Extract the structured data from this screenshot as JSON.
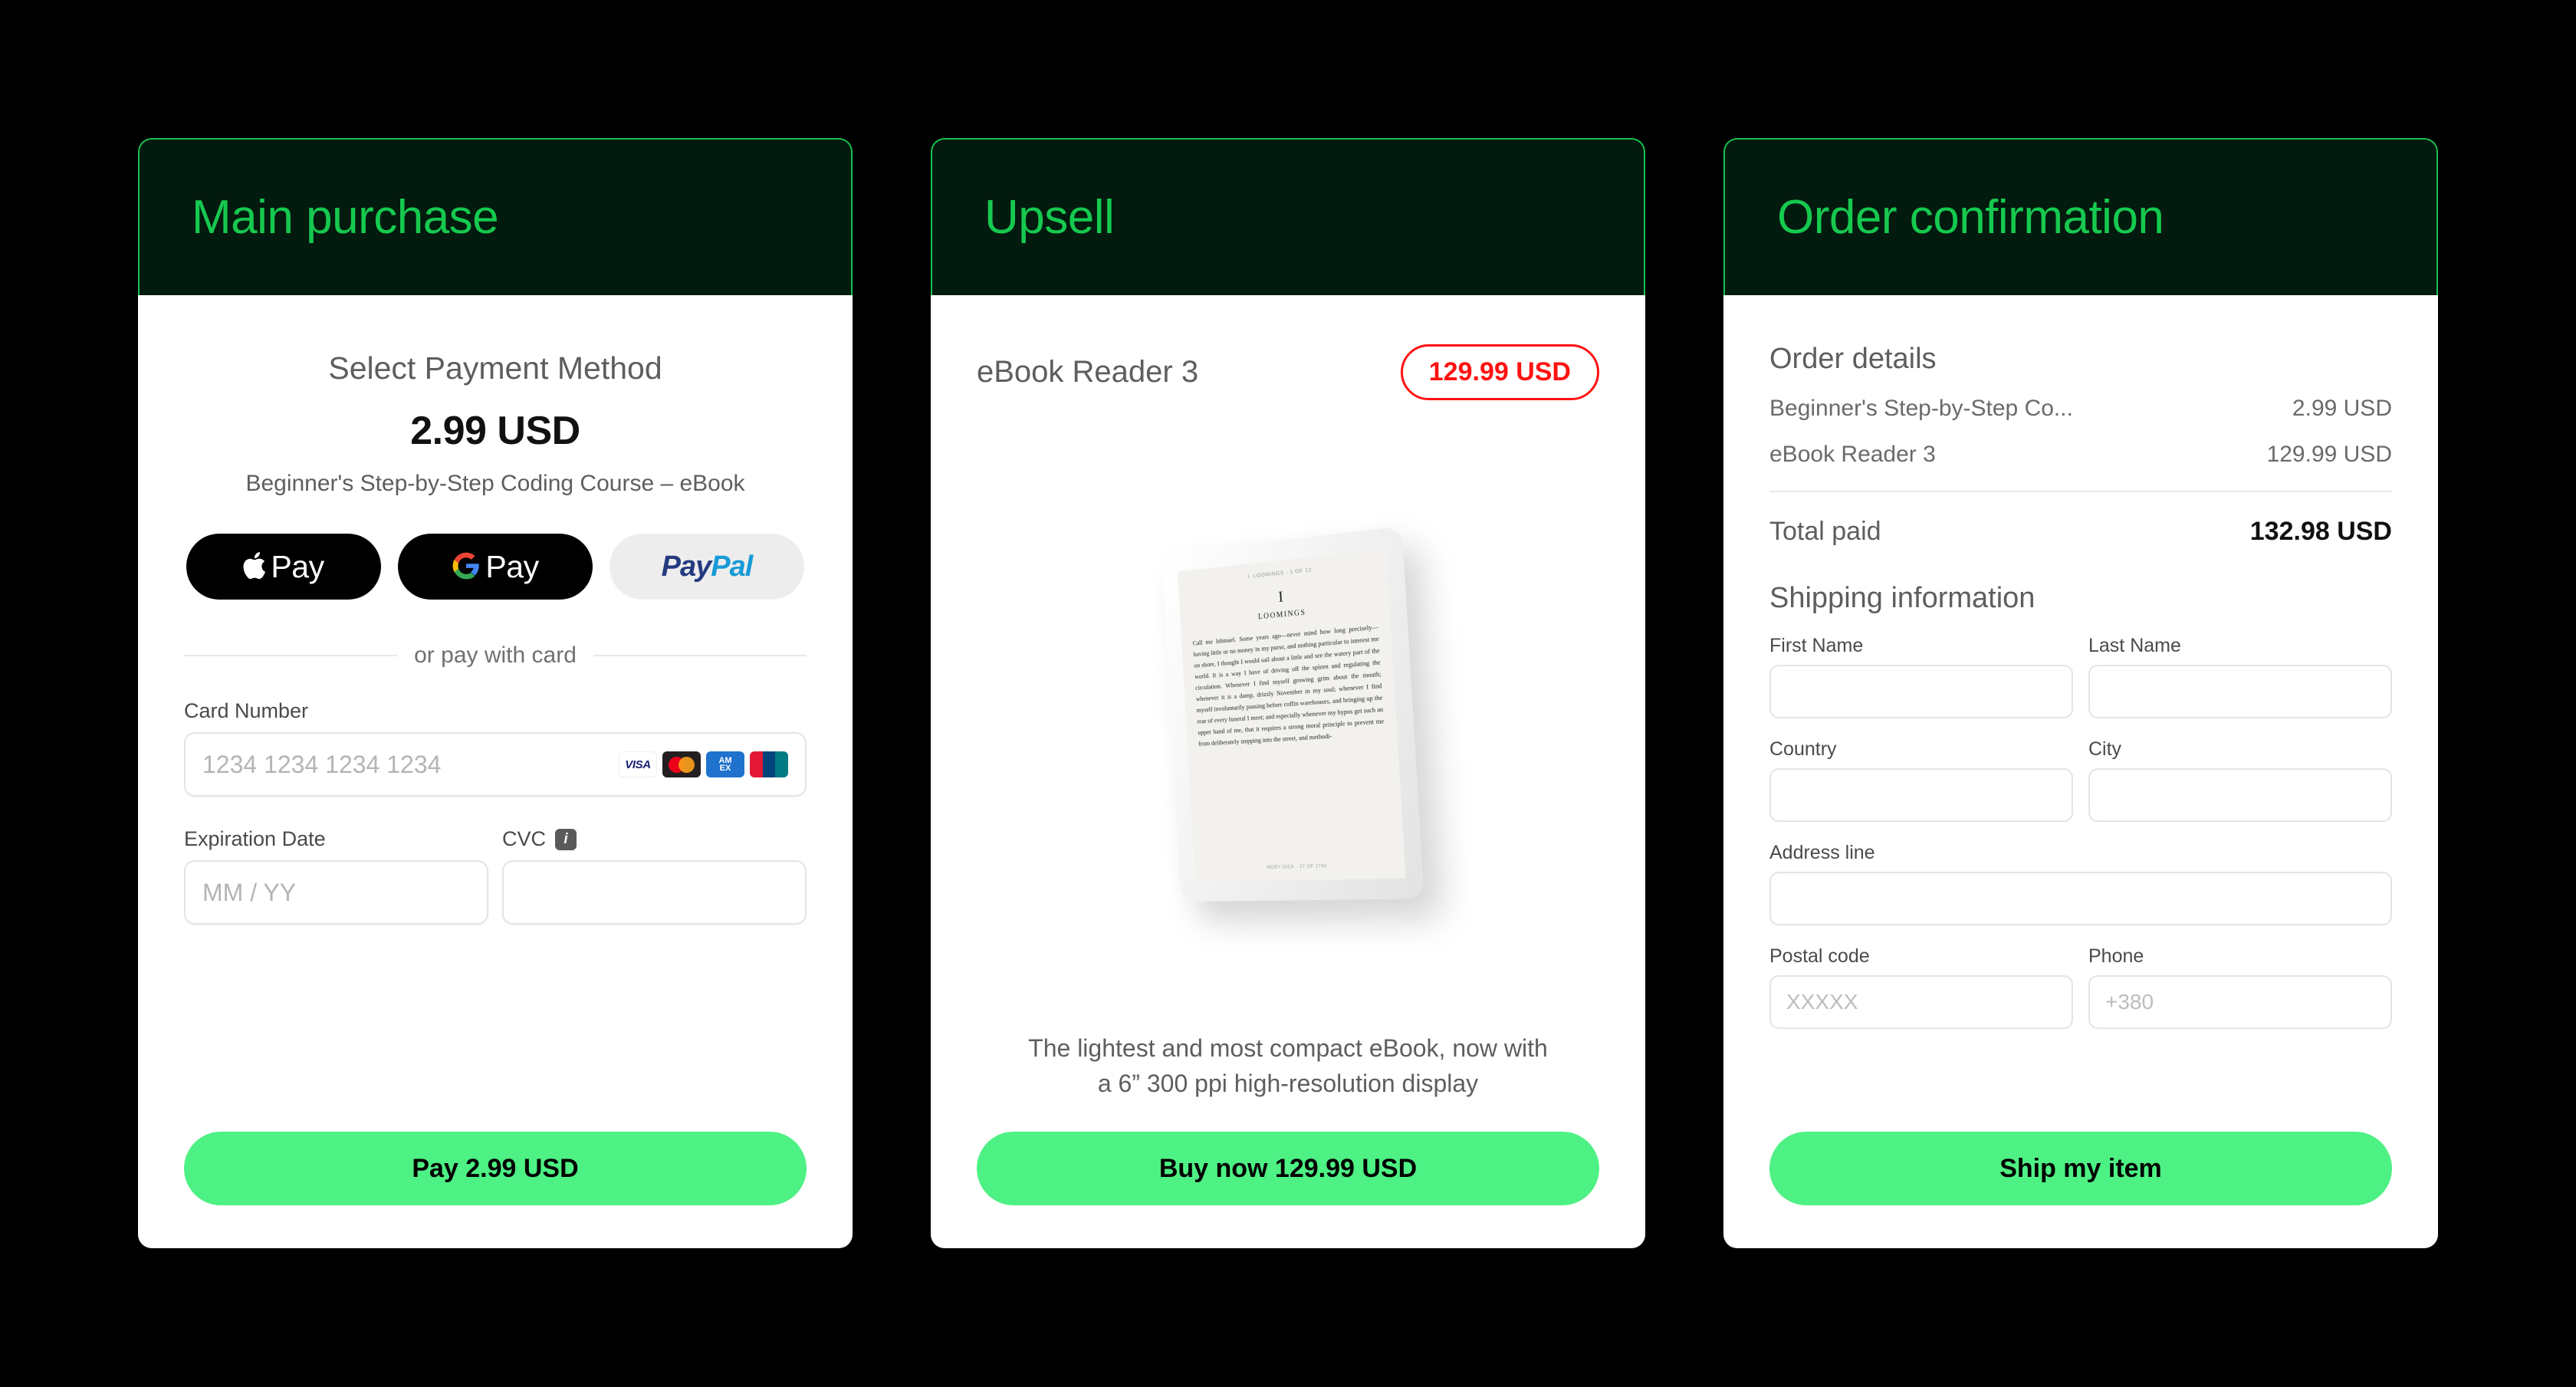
{
  "panels": {
    "main": {
      "title": "Main purchase",
      "select_payment_heading": "Select Payment Method",
      "amount": "2.99 USD",
      "product_name": "Beginner's Step-by-Step Coding Course – eBook",
      "wallets": [
        {
          "name": "apple-pay",
          "label": "Pay"
        },
        {
          "name": "google-pay",
          "label": "Pay"
        },
        {
          "name": "paypal",
          "label_a": "Pay",
          "label_b": "Pal"
        }
      ],
      "divider_label": "or pay with card",
      "card_number": {
        "label": "Card Number",
        "placeholder": "1234 1234 1234 1234",
        "brands": [
          "visa-icon",
          "mastercard-icon",
          "amex-icon",
          "unionpay-icon"
        ],
        "brand_labels": {
          "visa": "VISA",
          "amex_top": "AM",
          "amex_bottom": "EX",
          "unionpay": "UnionPay"
        }
      },
      "expiration": {
        "label": "Expiration Date",
        "placeholder": "MM / YY"
      },
      "cvc": {
        "label": "CVC",
        "placeholder": "",
        "info_icon": "info-icon",
        "info_glyph": "i"
      },
      "cta_label": "Pay 2.99 USD"
    },
    "upsell": {
      "title": "Upsell",
      "product_name": "eBook Reader 3",
      "price_badge": "129.99 USD",
      "device": {
        "screen_header": "I. LOOMINGS · 1 OF 13",
        "chapter_number": "I",
        "chapter_title": "LOOMINGS",
        "body_text": "Call me Ishmael. Some years ago—never mind how long precisely—having little or no money in my purse, and nothing particular to interest me on shore, I thought I would sail about a little and see the watery part of the world. It is a way I have of driving off the spleen and regulating the circulation. Whenever I find myself growing grim about the mouth; whenever it is a damp, drizzly November in my soul; whenever I find myself involuntarily pausing before coffin warehouses, and bringing up the rear of every funeral I meet; and especially whenever my hypos get such an upper hand of me, that it requires a strong moral principle to prevent me from deliberately stepping into the street, and methodi-",
        "screen_footer": "MOBY DICK · 27 OF 1786"
      },
      "description_line_1": "The lightest and most compact eBook, now with",
      "description_line_2": "a 6” 300 ppi high-resolution display",
      "cta_label": "Buy now 129.99 USD"
    },
    "confirmation": {
      "title": "Order confirmation",
      "order_details_heading": "Order details",
      "items": [
        {
          "name": "Beginner's Step-by-Step Co...",
          "price": "2.99 USD"
        },
        {
          "name": "eBook Reader 3",
          "price": "129.99 USD"
        }
      ],
      "total_label": "Total paid",
      "total_value": "132.98 USD",
      "shipping_heading": "Shipping information",
      "fields": {
        "first_name": {
          "label": "First Name",
          "placeholder": ""
        },
        "last_name": {
          "label": "Last Name",
          "placeholder": ""
        },
        "country": {
          "label": "Country",
          "placeholder": ""
        },
        "city": {
          "label": "City",
          "placeholder": ""
        },
        "address_line": {
          "label": "Address line",
          "placeholder": ""
        },
        "postal_code": {
          "label": "Postal code",
          "placeholder": "XXXXX"
        },
        "phone": {
          "label": "Phone",
          "placeholder": "+380"
        }
      },
      "cta_label": "Ship my item"
    }
  },
  "colors": {
    "background": "#000000",
    "header_bg": "#021B0E",
    "header_border": "#16C04E",
    "header_title": "#16C94F",
    "cta_green": "#4DF184",
    "price_red": "#FF1212",
    "card_white": "#FFFFFF"
  }
}
